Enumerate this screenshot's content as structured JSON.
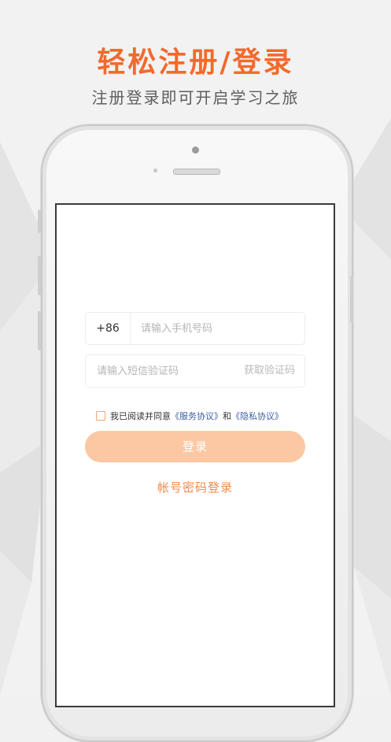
{
  "headline": "轻松注册/登录",
  "subline": "注册登录即可开启学习之旅",
  "form": {
    "country_code": "+86",
    "phone_placeholder": "请输入手机号码",
    "code_placeholder": "请输入短信验证码",
    "get_code_label": "获取验证码",
    "agreement_prefix": "我已阅读并同意",
    "service_agreement": "《服务协议》",
    "agreement_and": "和",
    "privacy_agreement": "《隐私协议》",
    "login_label": "登录",
    "password_login_label": "帐号密码登录"
  },
  "colors": {
    "accent": "#f26a2c",
    "login_button": "#fcc8a3",
    "link": "#3c5fa5"
  }
}
